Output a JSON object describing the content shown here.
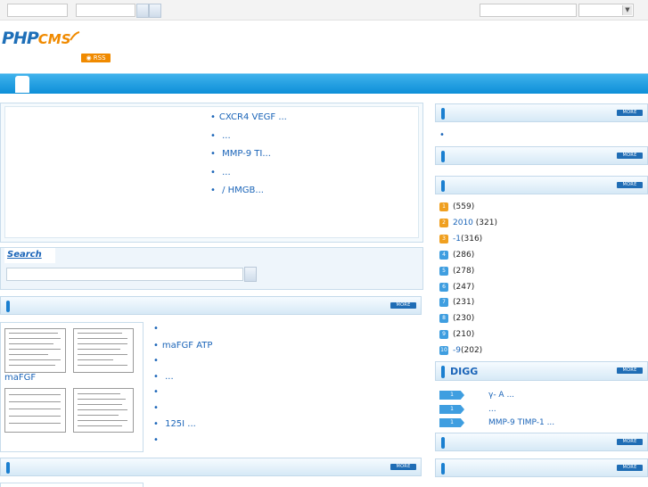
{
  "topbar": {
    "select_arrow": "▼"
  },
  "logo": {
    "php": "PHP",
    "cms": "CMS",
    "rss": "RSS"
  },
  "headlines": [
    "CXCR4 VEGF          ...",
    "          ...",
    "      MMP-9 TI...",
    "          ...",
    "     /      HMGB..."
  ],
  "search": {
    "title": "Search"
  },
  "boxes": {
    "more_label": "MORE"
  },
  "image_section": {
    "caption": "maFGF",
    "list": [
      "",
      "maFGF           ATP",
      "",
      "                  ...",
      "",
      "",
      "    125I               ...",
      ""
    ]
  },
  "ranking": [
    {
      "num": "1",
      "title": "      ",
      "count": "(559)",
      "color": "#f0a020"
    },
    {
      "num": "2",
      "title": "2010 ",
      "count": "(321)",
      "color": "#f0a020"
    },
    {
      "num": "3",
      "title": "       -1",
      "count": "(316)",
      "color": "#f0a020"
    },
    {
      "num": "4",
      "title": "     ",
      "count": "(286)",
      "color": "#3f9ee0"
    },
    {
      "num": "5",
      "title": "   ",
      "count": "(278)",
      "color": "#3f9ee0"
    },
    {
      "num": "6",
      "title": "     ",
      "count": "(247)",
      "color": "#3f9ee0"
    },
    {
      "num": "7",
      "title": "       ",
      "count": "(231)",
      "color": "#3f9ee0"
    },
    {
      "num": "8",
      "title": "   ",
      "count": "(230)",
      "color": "#3f9ee0"
    },
    {
      "num": "9",
      "title": "",
      "count": "(210)",
      "color": "#3f9ee0"
    },
    {
      "num": "10",
      "title": "   -9",
      "count": "(202)",
      "color": "#3f9ee0"
    }
  ],
  "digg": {
    "title": "DIGG",
    "items": [
      {
        "btn": "1",
        "title": "γ-   A   ..."
      },
      {
        "btn": "1",
        "title": "        ..."
      },
      {
        "btn": "1",
        "title": "MMP-9 TIMP-1   ..."
      }
    ]
  }
}
